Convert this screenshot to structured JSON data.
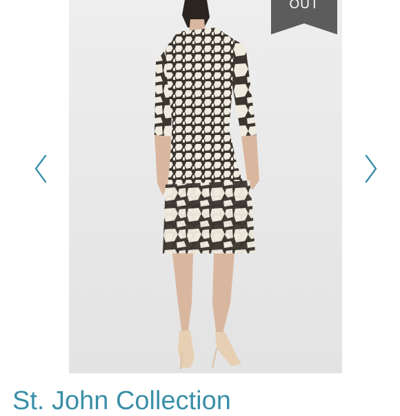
{
  "listing": {
    "title": "St. John Collection",
    "sold_badge": "OUT",
    "accent_color": "#3a8fa8",
    "badge_color": "#5c5c5c"
  },
  "carousel": {
    "prev_icon": "chevron-left-icon",
    "next_icon": "chevron-right-icon"
  },
  "photo": {
    "subject": "model in giraffe print dress, back view"
  }
}
